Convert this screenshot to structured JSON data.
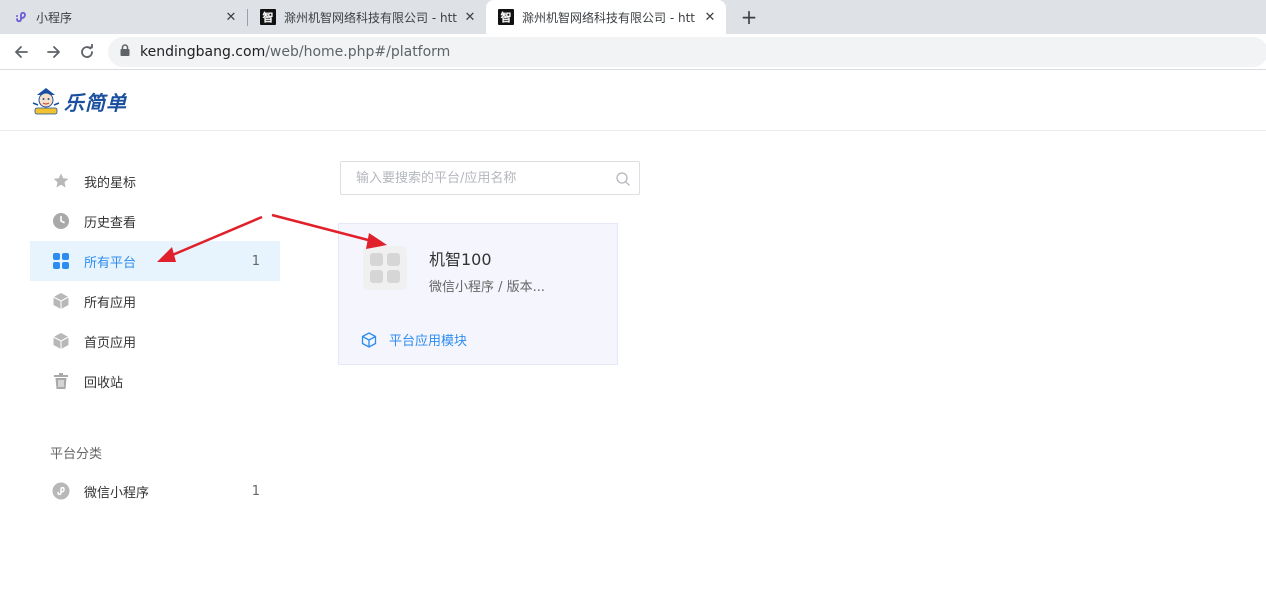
{
  "browser": {
    "tabs": [
      {
        "title": "小程序",
        "active": false
      },
      {
        "title": "滁州机智网络科技有限公司 - htt",
        "active": false
      },
      {
        "title": "滁州机智网络科技有限公司 - htt",
        "active": true
      }
    ],
    "favicon_char": "智",
    "close_glyph": "✕",
    "new_tab_glyph": "+",
    "url_host": "kendingbang.com",
    "url_path": "/web/home.php#/platform"
  },
  "header": {
    "logo_text": "乐简单"
  },
  "sidebar": {
    "items": [
      {
        "label": "我的星标",
        "count": "",
        "icon": "star-icon"
      },
      {
        "label": "历史查看",
        "count": "",
        "icon": "clock-icon"
      },
      {
        "label": "所有平台",
        "count": "1",
        "icon": "grid-icon",
        "active": true
      },
      {
        "label": "所有应用",
        "count": "",
        "icon": "cube-icon"
      },
      {
        "label": "首页应用",
        "count": "",
        "icon": "cube-icon"
      },
      {
        "label": "回收站",
        "count": "",
        "icon": "trash-icon"
      }
    ],
    "category_title": "平台分类",
    "categories": [
      {
        "label": "微信小程序",
        "count": "1",
        "icon": "mini-program-icon"
      }
    ]
  },
  "search": {
    "placeholder": "输入要搜索的平台/应用名称",
    "value": ""
  },
  "platform_card": {
    "title": "机智100",
    "subtitle": "微信小程序 / 版本...",
    "link_label": "平台应用模块"
  },
  "colors": {
    "accent": "#2d8cf0",
    "active_bg": "#e8f4fd",
    "annotation_arrow": "#e0202a"
  }
}
